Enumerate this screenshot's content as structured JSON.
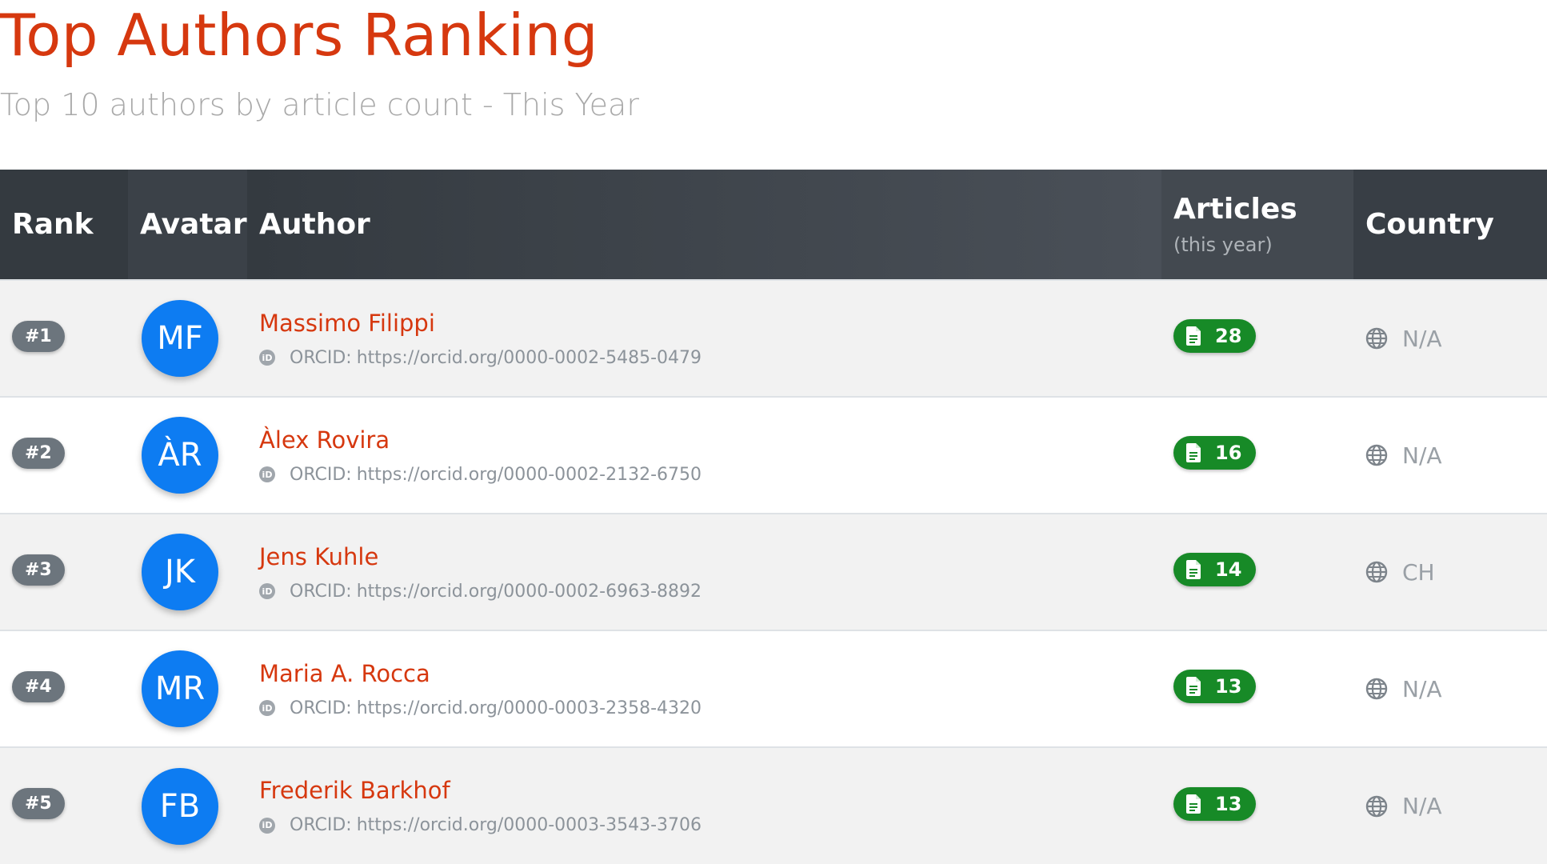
{
  "header": {
    "title": "Top Authors Ranking",
    "subtitle": "Top 10 authors by article count - This Year"
  },
  "table": {
    "columns": {
      "rank": "Rank",
      "avatar": "Avatar",
      "author": "Author",
      "articles": "Articles",
      "articles_sub": "(this year)",
      "country": "Country"
    },
    "orcid_label": "ORCID:",
    "rows": [
      {
        "rank": "#1",
        "initials": "MF",
        "name": "Massimo Filippi",
        "orcid": "https://orcid.org/0000-0002-5485-0479",
        "articles": "28",
        "country": "N/A"
      },
      {
        "rank": "#2",
        "initials": "ÀR",
        "name": "Àlex Rovira",
        "orcid": "https://orcid.org/0000-0002-2132-6750",
        "articles": "16",
        "country": "N/A"
      },
      {
        "rank": "#3",
        "initials": "JK",
        "name": "Jens Kuhle",
        "orcid": "https://orcid.org/0000-0002-6963-8892",
        "articles": "14",
        "country": "CH"
      },
      {
        "rank": "#4",
        "initials": "MR",
        "name": "Maria A. Rocca",
        "orcid": "https://orcid.org/0000-0003-2358-4320",
        "articles": "13",
        "country": "N/A"
      },
      {
        "rank": "#5",
        "initials": "FB",
        "name": "Frederik Barkhof",
        "orcid": "https://orcid.org/0000-0003-3543-3706",
        "articles": "13",
        "country": "N/A"
      }
    ]
  },
  "colors": {
    "accent": "#d6380f",
    "header_bg": "#343a40",
    "avatar_bg": "#0d7cf2",
    "articles_badge": "#178a27",
    "rank_badge": "#6c757d"
  },
  "icons": {
    "orcid": "orcid-icon",
    "articles": "document-icon",
    "country": "globe-icon"
  }
}
